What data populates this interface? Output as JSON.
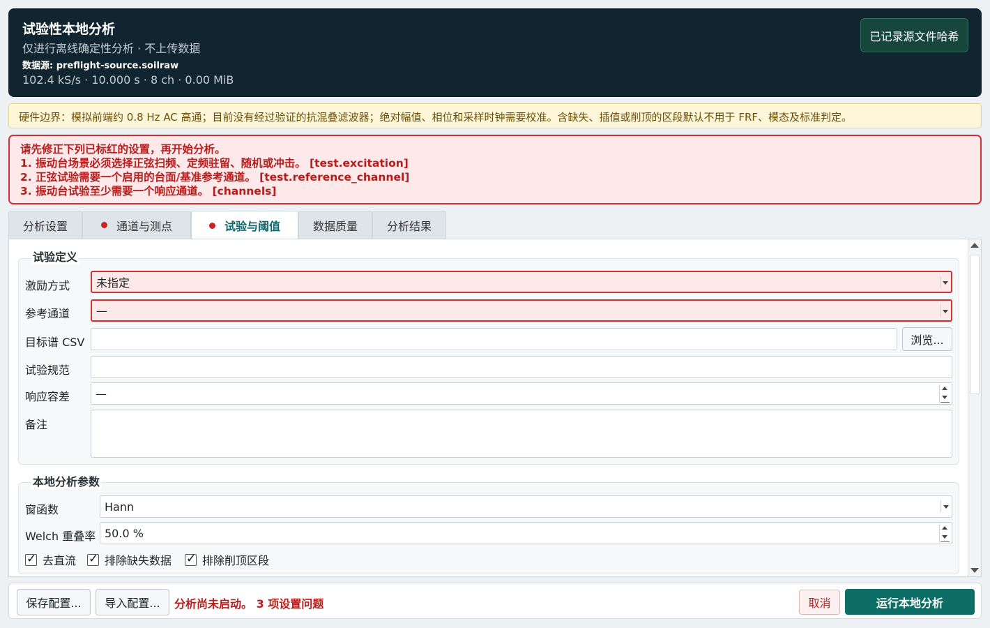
{
  "header": {
    "title": "试验性本地分析",
    "subtitle": "仅进行离线确定性分析 · 不上传数据",
    "source_line": "数据源: preflight-source.soilraw",
    "meta_line": "102.4 kS/s · 10.000 s · 8 ch · 0.00 MiB",
    "hash_button": "已记录源文件哈希"
  },
  "hardware_warning": "硬件边界：模拟前端约 0.8 Hz AC 高通；目前没有经过验证的抗混叠滤波器；绝对幅值、相位和采样时钟需要校准。含缺失、插值或削顶的区段默认不用于 FRF、模态及标准判定。",
  "errors": {
    "intro": "请先修正下列已标红的设置，再开始分析。",
    "items": [
      "1. 振动台场景必须选择正弦扫频、定频驻留、随机或冲击。 [test.excitation]",
      "2. 正弦试验需要一个启用的台面/基准参考通道。 [test.reference_channel]",
      "3. 振动台试验至少需要一个响应通道。 [channels]"
    ]
  },
  "tabs": [
    {
      "label": "分析设置",
      "error": false
    },
    {
      "label": "通道与测点",
      "error": true
    },
    {
      "label": "试验与阈值",
      "error": true,
      "active": true
    },
    {
      "label": "数据质量",
      "error": false
    },
    {
      "label": "分析结果",
      "error": false
    }
  ],
  "test_definition": {
    "title": "试验定义",
    "excitation_label": "激励方式",
    "excitation_value": "未指定",
    "reference_label": "参考通道",
    "reference_value": "—",
    "target_csv_label": "目标谱 CSV",
    "target_csv_value": "",
    "browse_label": "浏览...",
    "spec_label": "试验规范",
    "spec_value": "",
    "tolerance_label": "响应容差",
    "tolerance_value": "—",
    "notes_label": "备注",
    "notes_value": ""
  },
  "analysis_params": {
    "title": "本地分析参数",
    "window_label": "窗函数",
    "window_value": "Hann",
    "overlap_label": "Welch 重叠率",
    "overlap_value": "50.0 %",
    "checkboxes": [
      {
        "label": "去直流",
        "checked": true
      },
      {
        "label": "排除缺失数据",
        "checked": true
      },
      {
        "label": "排除削顶区段",
        "checked": true
      }
    ]
  },
  "footer": {
    "save_label": "保存配置...",
    "import_label": "导入配置...",
    "status": "分析尚未启动。 3 项设置问题",
    "cancel_label": "取消",
    "run_label": "运行本地分析"
  },
  "colors": {
    "header_bg": "#10252f",
    "error": "#cc3434",
    "accent": "#0d6e66",
    "warning_bg": "#fdf6d8"
  }
}
